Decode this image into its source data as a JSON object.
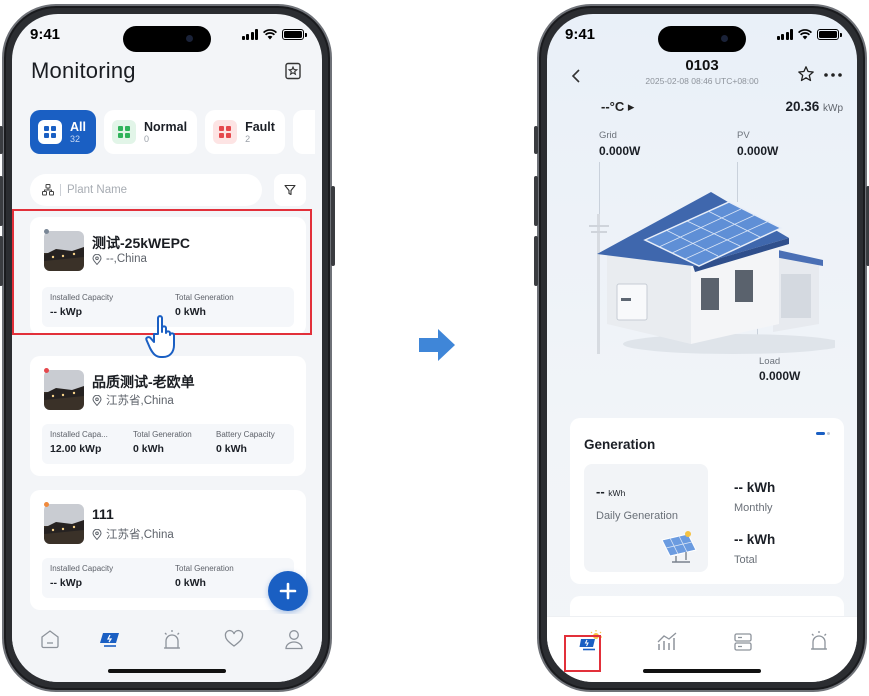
{
  "left_phone": {
    "status_time": "9:41",
    "title": "Monitoring",
    "filters": [
      {
        "label": "All",
        "count": "32",
        "active": true
      },
      {
        "label": "Normal",
        "count": "0",
        "active": false
      },
      {
        "label": "Fault",
        "count": "2",
        "active": false
      }
    ],
    "search_placeholder": "Plant Name",
    "plants": [
      {
        "name": "测试-25kWEPC",
        "location": "--,China",
        "status_color": "#7a8796",
        "stats": [
          {
            "label": "Installed Capacity",
            "value": "-- kWp"
          },
          {
            "label": "Total Generation",
            "value": "0 kWh"
          }
        ]
      },
      {
        "name": "品质测试-老欧单",
        "location": "江苏省,China",
        "status_color": "#e5484d",
        "stats": [
          {
            "label": "Installed Capa...",
            "value": "12.00 kWp"
          },
          {
            "label": "Total Generation",
            "value": "0 kWh"
          },
          {
            "label": "Battery Capacity",
            "value": "0 kWh"
          }
        ]
      },
      {
        "name": "111",
        "location": "江苏省,China",
        "status_color": "#f08a3c",
        "stats": [
          {
            "label": "Installed Capacity",
            "value": "-- kWp"
          },
          {
            "label": "Total Generation",
            "value": "0 kWh"
          }
        ]
      }
    ],
    "tabs": [
      "home-icon",
      "solar-station-icon",
      "alarm-icon",
      "heart-icon",
      "profile-icon"
    ],
    "active_tab": "solar-station-icon"
  },
  "right_phone": {
    "status_time": "9:41",
    "plant_title": "0103",
    "plant_time": "2025-02-08 08:46 UTC+08:00",
    "temperature": "--°C ▸",
    "capacity_value": "20.36",
    "capacity_unit": "kWp",
    "grid": {
      "label": "Grid",
      "value": "0.000W"
    },
    "pv": {
      "label": "PV",
      "value": "0.000W"
    },
    "load": {
      "label": "Load",
      "value": "0.000W"
    },
    "generation": {
      "title": "Generation",
      "daily_value": "--",
      "daily_unit": "kWh",
      "daily_label": "Daily Generation",
      "monthly_value": "-- kWh",
      "monthly_label": "Monthly",
      "total_value": "-- kWh",
      "total_label": "Total"
    },
    "tabs": [
      "plant-overview-icon",
      "statistics-icon",
      "device-icon",
      "alarm-icon"
    ],
    "active_tab": "plant-overview-icon"
  },
  "colors": {
    "accent": "#1a5fc3",
    "highlight": "#e2303a",
    "arrow": "#3f86d8"
  }
}
